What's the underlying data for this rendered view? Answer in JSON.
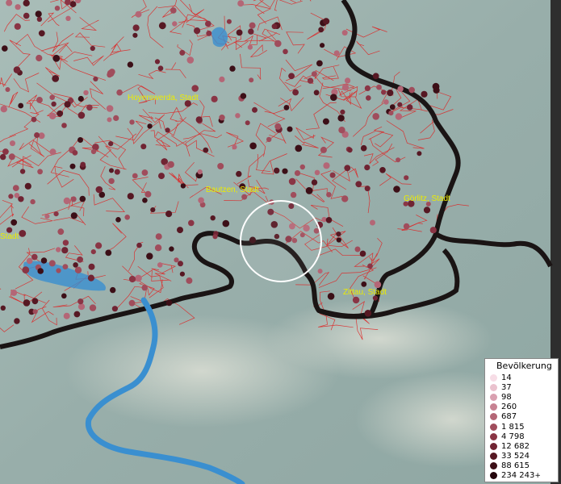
{
  "map": {
    "cities": [
      {
        "name": "Hoyerswerda, Stadt"
      },
      {
        "name": "Bautzen, Stadt"
      },
      {
        "name": "Görlitz, Stadt"
      },
      {
        "name": "Zittau, Stadt"
      },
      {
        "name": "Stadt"
      }
    ],
    "colors": {
      "terrain": "#9fb4b0",
      "district_lines": "#e02020",
      "border": "#1a1414",
      "water": "#3a8fd0",
      "label": "#ecec00"
    }
  },
  "legend": {
    "title": "Bevölkerung",
    "classes": [
      {
        "label": "14",
        "color": "#f7dde6"
      },
      {
        "label": "37",
        "color": "#eac2ce"
      },
      {
        "label": "98",
        "color": "#d9a0b0"
      },
      {
        "label": "260",
        "color": "#c78292"
      },
      {
        "label": "687",
        "color": "#b46676"
      },
      {
        "label": "1 815",
        "color": "#a04d5c"
      },
      {
        "label": "4 798",
        "color": "#8a3545"
      },
      {
        "label": "12 682",
        "color": "#702433"
      },
      {
        "label": "33 524",
        "color": "#561823"
      },
      {
        "label": "88 615",
        "color": "#3c0f17"
      },
      {
        "label": "234 243",
        "color": "#24060c"
      }
    ],
    "overflow_marker": "+"
  }
}
